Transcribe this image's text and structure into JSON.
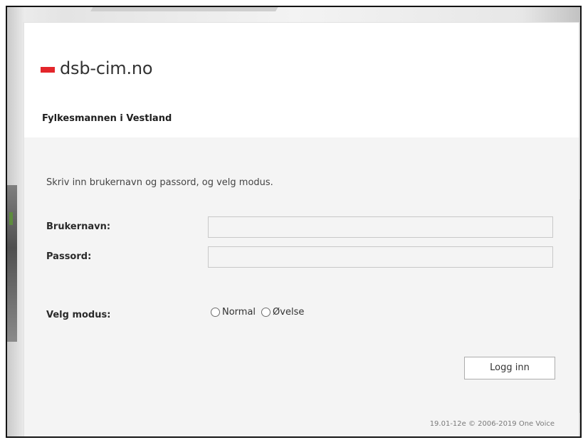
{
  "brand": {
    "name": "dsb-cim.no",
    "accent_color": "#e3262b"
  },
  "organization": "Fylkesmannen i Vestland",
  "form": {
    "instructions": "Skriv inn brukernavn og passord, og velg modus.",
    "username_label": "Brukernavn:",
    "username_value": "",
    "password_label": "Passord:",
    "password_value": "",
    "mode_label": "Velg modus:",
    "mode_options": [
      {
        "label": "Normal",
        "selected": false
      },
      {
        "label": "Øvelse",
        "selected": false
      }
    ],
    "submit_label": "Logg inn"
  },
  "footer": {
    "version_text": "19.01-12e © 2006-2019 One Voice"
  }
}
